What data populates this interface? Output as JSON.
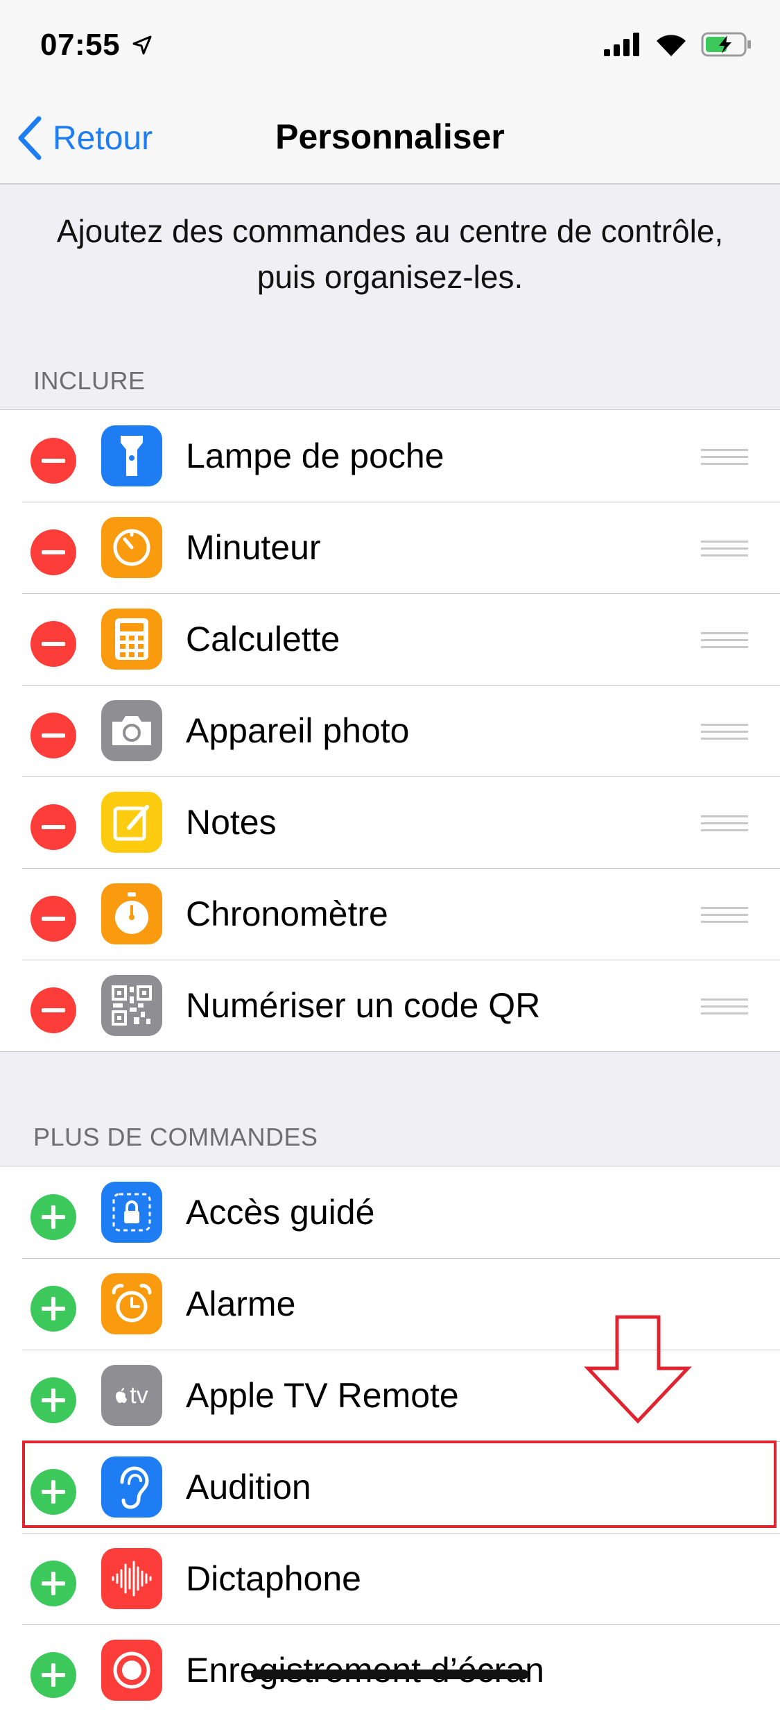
{
  "status": {
    "time": "07:55"
  },
  "nav": {
    "back_label": "Retour",
    "title": "Personnaliser"
  },
  "intro_text": "Ajoutez des commandes au centre de contrôle, puis organisez-les.",
  "sections": {
    "include": {
      "header": "INCLURE",
      "items": [
        {
          "label": "Lampe de poche",
          "icon": "flashlight-icon",
          "color": "#1e7df3"
        },
        {
          "label": "Minuteur",
          "icon": "timer-icon",
          "color": "#f99a0f"
        },
        {
          "label": "Calculette",
          "icon": "calculator-icon",
          "color": "#f99a0f"
        },
        {
          "label": "Appareil photo",
          "icon": "camera-icon",
          "color": "#8e8e93"
        },
        {
          "label": "Notes",
          "icon": "notes-icon",
          "color": "#fdcb10"
        },
        {
          "label": "Chronomètre",
          "icon": "stopwatch-icon",
          "color": "#f99a0f"
        },
        {
          "label": "Numériser un code QR",
          "icon": "qr-code-icon",
          "color": "#8e8e93"
        }
      ]
    },
    "more": {
      "header": "PLUS DE COMMANDES",
      "items": [
        {
          "label": "Accès guidé",
          "icon": "guided-access-icon",
          "color": "#1e7df3"
        },
        {
          "label": "Alarme",
          "icon": "alarm-clock-icon",
          "color": "#f99a0f"
        },
        {
          "label": "Apple TV Remote",
          "icon": "apple-tv-icon",
          "color": "#8e8e93",
          "icon_text": "tv"
        },
        {
          "label": "Audition",
          "icon": "ear-icon",
          "color": "#1e7df3"
        },
        {
          "label": "Dictaphone",
          "icon": "voice-memo-icon",
          "color": "#fc3d39"
        },
        {
          "label": "Enregistrement d’écran",
          "icon": "screen-record-icon",
          "color": "#fc3d39"
        }
      ]
    }
  },
  "colors": {
    "accent": "#1e7df3",
    "remove": "#fc3d39",
    "add": "#3cc85a",
    "annotation": "#e0232f"
  }
}
